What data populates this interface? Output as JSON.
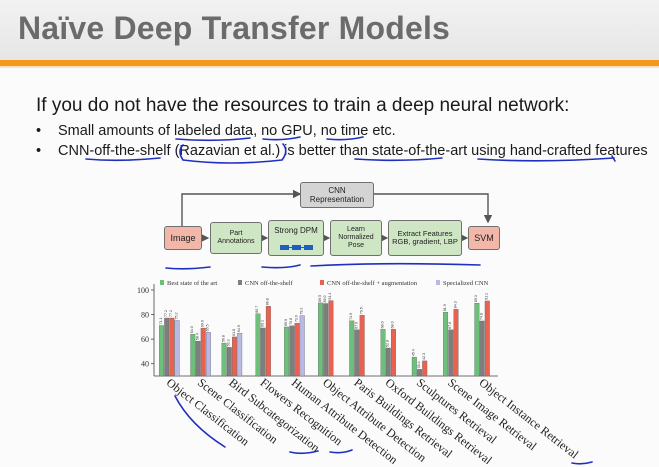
{
  "slide": {
    "title": "Naïve Deep Transfer Models",
    "lead": "If you do not have the resources to train a deep neural network:",
    "bullets": [
      "Small amounts of labeled data, no GPU, no time etc.",
      "CNN-off-the-shelf (Razavian et al.) is better than state-of-the-art using hand-crafted features"
    ],
    "bullet_marker": "•"
  },
  "pipeline": {
    "image": "Image",
    "part_annotations": "Part Annotations",
    "strong_dpm": "Strong DPM",
    "learn_pose": "Learn Normalized Pose",
    "extract_features": "Extract Features RGB, gradient, LBP",
    "svm": "SVM",
    "cnn_representation": "CNN Representation"
  },
  "colors": {
    "orange_rule": "#f39a1c",
    "pen_blue": "#1f2fbf",
    "series": [
      "#6cc07a",
      "#7e7e7e",
      "#e9614f",
      "#b9b9e6"
    ]
  },
  "chart_data": {
    "type": "bar",
    "ylim": [
      30,
      100
    ],
    "yticks": [
      40,
      60,
      80,
      100
    ],
    "legend_position": "top",
    "categories": [
      "Object Classification",
      "Scene Classification",
      "Bird Subcategorization",
      "Flowers Recognition",
      "Human Attribute Detection",
      "Object Attribute Detection",
      "Paris Buildings Retrieval",
      "Oxford Buildings Retrieval",
      "Sculptures Retrieval",
      "Scene Image Retrieval",
      "Object Instance Retrieval"
    ],
    "series": [
      {
        "name": "Best state of the art",
        "values": [
          71.1,
          64.0,
          56.8,
          80.7,
          69.9,
          89.5,
          74.9,
          68.0,
          45.4,
          81.9,
          89.3
        ]
      },
      {
        "name": "CNN off-the-shelf",
        "values": [
          77.2,
          58.4,
          53.3,
          69.1,
          70.8,
          89.0,
          67.6,
          52.8,
          35.4,
          67.6,
          74.8
        ]
      },
      {
        "name": "CNN off-the-shelf + augmentation",
        "values": [
          77.2,
          69.0,
          61.8,
          86.8,
          73.0,
          91.4,
          79.5,
          68.0,
          42.3,
          84.3,
          91.1
        ]
      },
      {
        "name": "Specialized CNN",
        "values": [
          75.2,
          65.5,
          64.9,
          null,
          79.2,
          null,
          null,
          null,
          null,
          null,
          null
        ]
      }
    ]
  }
}
